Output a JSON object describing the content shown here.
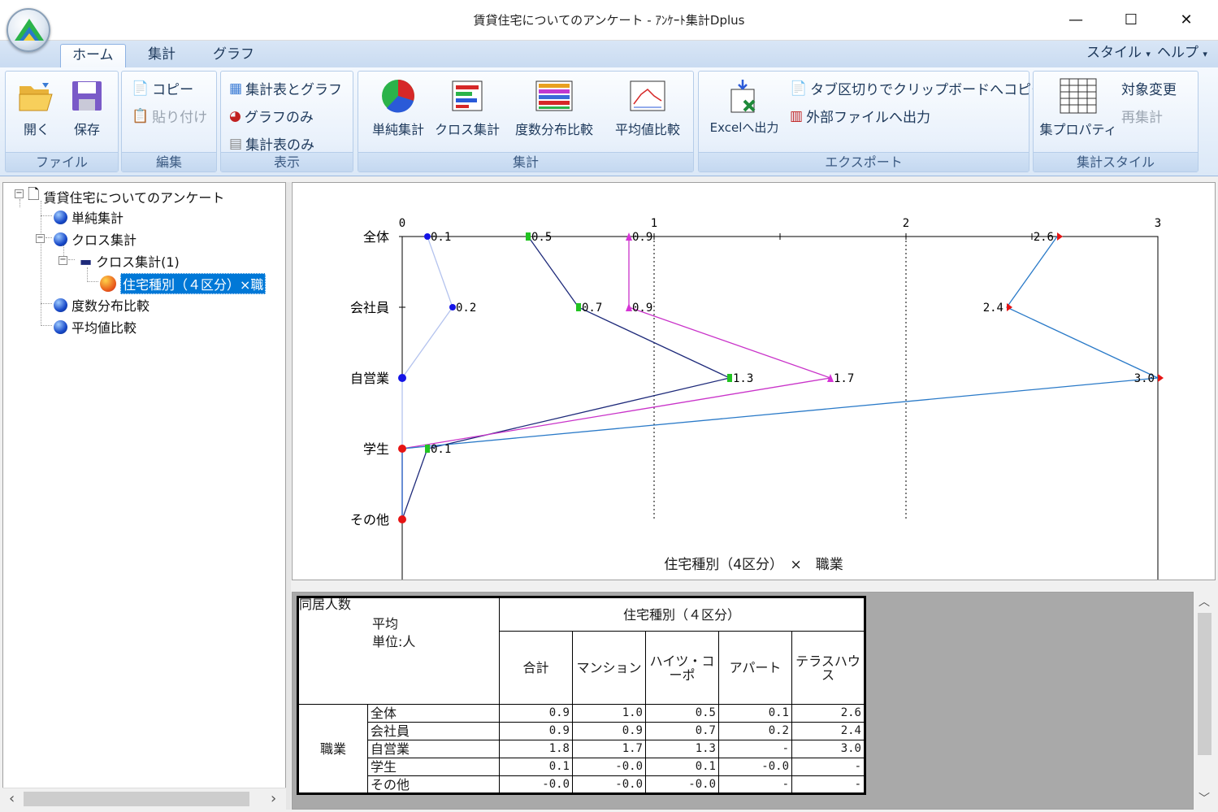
{
  "window": {
    "title": "賃貸住宅についてのアンケート - ｱﾝｹｰﾄ集計Dplus",
    "minimize": "—",
    "maximize": "☐",
    "close": "✕"
  },
  "tabs": [
    {
      "label": "ホーム"
    },
    {
      "label": "集計"
    },
    {
      "label": "グラフ"
    }
  ],
  "menu_right": {
    "style": "スタイル",
    "help": "ヘルプ",
    "caret": "▾"
  },
  "ribbon": {
    "file": {
      "label": "ファイル",
      "open": "開く",
      "save": "保存"
    },
    "edit": {
      "label": "編集",
      "copy": "コピー",
      "paste": "貼り付け"
    },
    "view": {
      "label": "表示",
      "table_graph": "集計表とグラフ",
      "graph_only": "グラフのみ",
      "table_only": "集計表のみ"
    },
    "aggregate": {
      "label": "集計",
      "simple": "単純集計",
      "cross": "クロス集計",
      "freq": "度数分布比較",
      "mean": "平均値比較"
    },
    "export": {
      "label": "エクスポート",
      "excel": "Excelへ出力",
      "clip": "タブ区切りでクリップボードへコピー",
      "ext": "外部ファイルへ出力"
    },
    "style": {
      "label": "集計スタイル",
      "prop": "集プロパティ",
      "target": "対象変更",
      "recalc": "再集計"
    }
  },
  "tree": {
    "root": "賃貸住宅についてのアンケート",
    "simple": "単純集計",
    "cross": "クロス集計",
    "cross1": "クロス集計(1)",
    "item": "住宅種別（４区分）×職",
    "freq": "度数分布比較",
    "mean": "平均値比較"
  },
  "chart_data": {
    "type": "line",
    "title": "住宅種別（4区分）　×　職業",
    "orientation": "horizontal",
    "categories": [
      "全体",
      "会社員",
      "自営業",
      "学生",
      "その他"
    ],
    "xlim": [
      0,
      3
    ],
    "xticks": [
      "0",
      "1",
      "2",
      "3"
    ],
    "series": [
      {
        "marker": "circle",
        "color": "#b4c3ee",
        "values": [
          0.1,
          0.2,
          0.0,
          0.0,
          0.0
        ],
        "labels": [
          "0.1",
          "0.2",
          "",
          "",
          ""
        ]
      },
      {
        "marker": "square",
        "color": "#1e2a7a",
        "values": [
          0.5,
          0.7,
          1.3,
          0.1,
          0.0
        ],
        "labels": [
          "0.5",
          "0.7",
          "1.3",
          "0.1",
          ""
        ]
      },
      {
        "marker": "triangle-up",
        "color": "#c933c9",
        "values": [
          0.9,
          0.9,
          1.7,
          0.0,
          0.0
        ],
        "labels": [
          "0.9",
          "0.9",
          "1.7",
          "",
          ""
        ]
      },
      {
        "marker": "triangle-right",
        "color": "#2a7ac8",
        "values": [
          2.6,
          2.4,
          3.0,
          0.0,
          0.0
        ],
        "labels": [
          "2.6",
          "2.4",
          "3.0",
          "",
          ""
        ]
      }
    ],
    "colors": {
      "circle": "#1414e6",
      "square": "#22c322",
      "triangle-up": "#d633d6",
      "triangle-right": "#e61414",
      "origin": "#e61414"
    }
  },
  "table": {
    "corner": {
      "var": "同居人数",
      "stat": "平均",
      "unit": "単位:人"
    },
    "col_header": "住宅種別（４区分）",
    "row_var": "職業",
    "columns": [
      "合計",
      "マンション",
      "ハイツ・コーポ",
      "アパート",
      "テラスハウス"
    ],
    "rows": [
      {
        "label": "全体",
        "cells": [
          "0.9",
          "1.0",
          "0.5",
          "0.1",
          "2.6"
        ]
      },
      {
        "label": "会社員",
        "cells": [
          "0.9",
          "0.9",
          "0.7",
          "0.2",
          "2.4"
        ]
      },
      {
        "label": "自営業",
        "cells": [
          "1.8",
          "1.7",
          "1.3",
          "-",
          "3.0"
        ]
      },
      {
        "label": "学生",
        "cells": [
          "0.1",
          "-0.0",
          "0.1",
          "-0.0",
          "-"
        ]
      },
      {
        "label": "その他",
        "cells": [
          "-0.0",
          "-0.0",
          "-0.0",
          "-",
          "-"
        ]
      }
    ]
  },
  "scroll": {
    "left": "‹",
    "right": "›",
    "up": "︿",
    "down": "﹀"
  }
}
